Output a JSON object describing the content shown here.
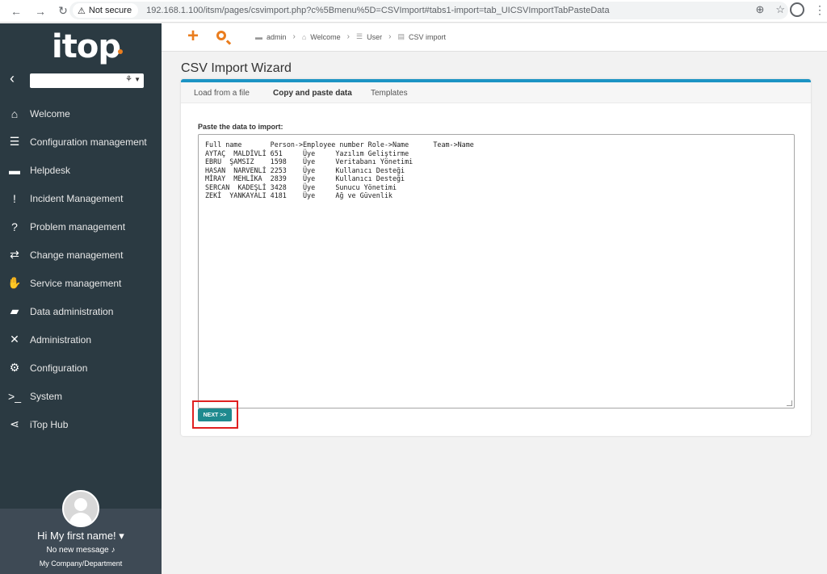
{
  "browser": {
    "security_label": "Not secure",
    "url": "192.168.1.100/itsm/pages/csvimport.php?c%5Bmenu%5D=CSVImport#tabs1-import=tab_UICSVImportTabPasteData"
  },
  "sidebar": {
    "logo": "itop",
    "menu": [
      {
        "label": "Welcome",
        "icon": "home-icon"
      },
      {
        "label": "Configuration management",
        "icon": "database-icon"
      },
      {
        "label": "Helpdesk",
        "icon": "chat-icon"
      },
      {
        "label": "Incident Management",
        "icon": "exclamation-icon"
      },
      {
        "label": "Problem management",
        "icon": "question-icon"
      },
      {
        "label": "Change management",
        "icon": "exchange-icon"
      },
      {
        "label": "Service management",
        "icon": "handshake-icon"
      },
      {
        "label": "Data administration",
        "icon": "folder-icon"
      },
      {
        "label": "Administration",
        "icon": "tools-icon"
      },
      {
        "label": "Configuration",
        "icon": "gear-icon"
      },
      {
        "label": "System",
        "icon": "terminal-icon"
      },
      {
        "label": "iTop Hub",
        "icon": "share-icon"
      }
    ],
    "user": {
      "greeting": "Hi My first name!",
      "messages": "No new message",
      "company": "My Company/Department"
    }
  },
  "breadcrumb": [
    {
      "label": "admin"
    },
    {
      "label": "Welcome"
    },
    {
      "label": "User"
    },
    {
      "label": "CSV import"
    }
  ],
  "page": {
    "title": "CSV Import Wizard",
    "tabs": [
      "Load from a file",
      "Copy and paste data",
      "Templates"
    ],
    "active_tab": "Copy and paste data",
    "paste_label": "Paste the data to import:",
    "paste_content": "Full name       Person->Employee number Role->Name      Team->Name\nAYTAÇ  MALDİVLİ 651     Üye     Yazılım Geliştirme\nEBRU  ŞAMSIZ    1598    Üye     Veritabanı Yönetimi\nHASAN  NARVENLİ 2253    Üye     Kullanıcı Desteği\nMİRAY  MEHLİKA  2839    Üye     Kullanıcı Desteği\nSERCAN  KADEŞLİ 3428    Üye     Sunucu Yönetimi\nZEKİ  YANKAYALI 4181    Üye     Ağ ve Güvenlik",
    "next_button": "NEXT >>"
  },
  "colors": {
    "sidebar_bg": "#2b3a42",
    "accent": "#ea7d1e",
    "panel_border": "#1c94c4",
    "next_button": "#1f8a8f",
    "highlight": "#e02020"
  }
}
